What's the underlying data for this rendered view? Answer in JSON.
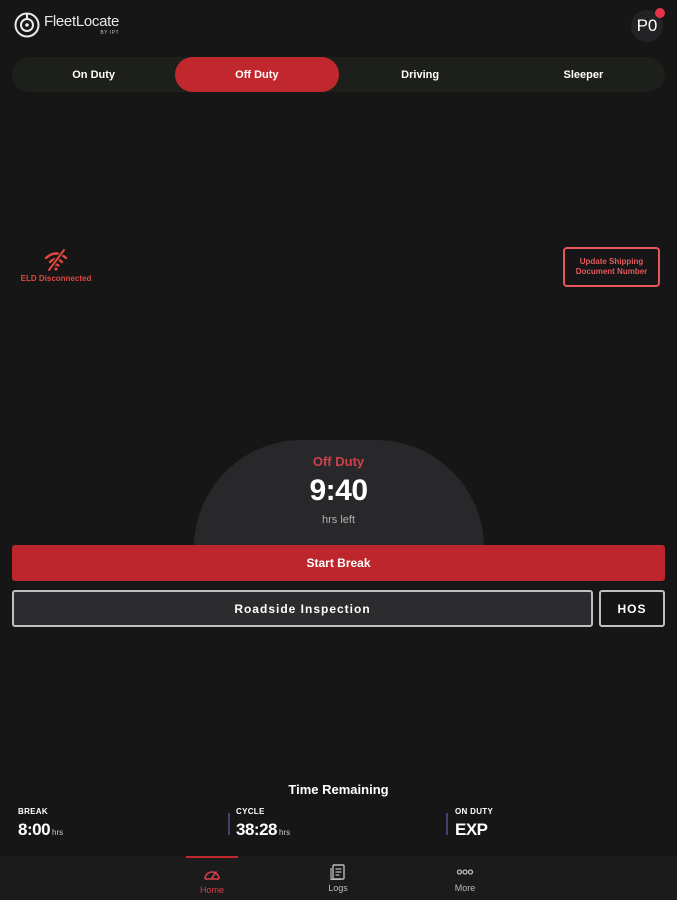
{
  "app": {
    "logo_name": "FleetLocate",
    "logo_sub": "BY IPT",
    "avatar_initials": "P0",
    "accent_color": "#c0282e"
  },
  "status_tabs": [
    {
      "label": "On Duty",
      "active": false
    },
    {
      "label": "Off Duty",
      "active": true
    },
    {
      "label": "Driving",
      "active": false
    },
    {
      "label": "Sleeper",
      "active": false
    }
  ],
  "eld": {
    "label": "ELD Disconnected",
    "icon": "wifi-off-icon"
  },
  "shipping_button": {
    "label": "Update Shipping Document Number"
  },
  "clock": {
    "status": "Off Duty",
    "time": "9:40",
    "unit": "hrs left"
  },
  "actions": {
    "start_break": "Start Break",
    "roadside_inspection": "Roadside Inspection",
    "hos": "HOS"
  },
  "time_remaining": {
    "title": "Time Remaining",
    "items": [
      {
        "label": "BREAK",
        "value": "8:00",
        "unit": "hrs"
      },
      {
        "label": "CYCLE",
        "value": "38:28",
        "unit": "hrs"
      },
      {
        "label": "ON DUTY",
        "value": "EXP",
        "unit": ""
      }
    ]
  },
  "bottom_nav": [
    {
      "label": "Home",
      "icon": "speedometer-icon",
      "active": true
    },
    {
      "label": "Logs",
      "icon": "logs-icon",
      "active": false
    },
    {
      "label": "More",
      "icon": "more-dots-icon",
      "active": false
    }
  ]
}
